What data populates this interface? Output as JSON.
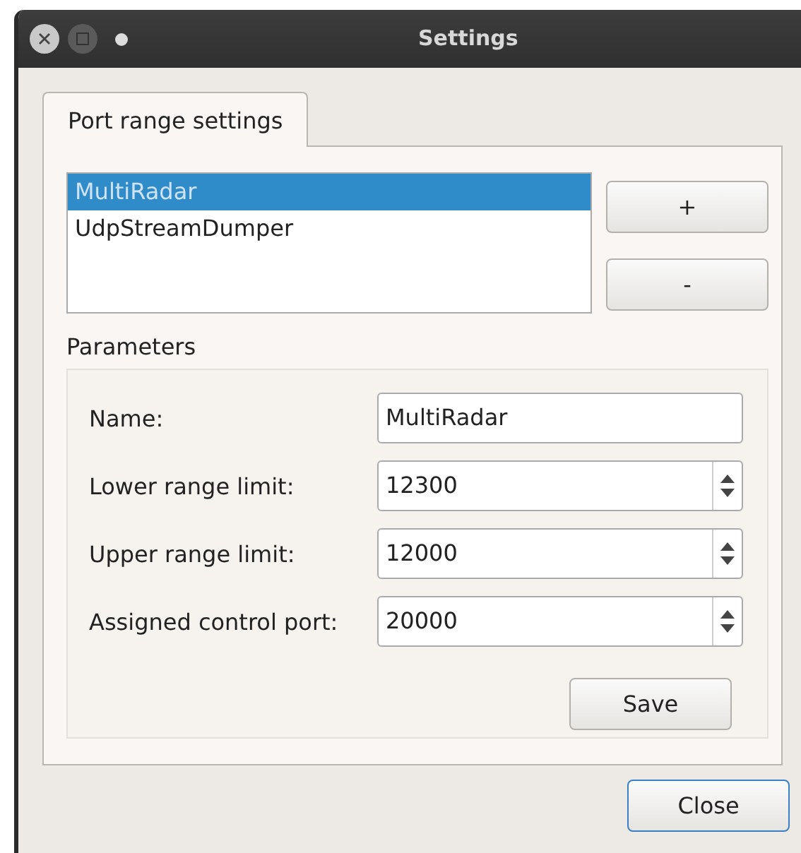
{
  "window": {
    "title": "Settings"
  },
  "tabs": [
    {
      "label": "Port range settings",
      "selected": true
    }
  ],
  "list": {
    "items": [
      {
        "label": "MultiRadar",
        "selected": true
      },
      {
        "label": "UdpStreamDumper",
        "selected": false
      }
    ]
  },
  "list_buttons": [
    "+",
    "-"
  ],
  "parameters": {
    "title": "Parameters",
    "fields": [
      {
        "kind": "text",
        "label": "Name:",
        "value": "MultiRadar"
      },
      {
        "kind": "spin",
        "label": "Lower range limit:",
        "value": "12300"
      },
      {
        "kind": "spin",
        "label": "Upper range limit:",
        "value": "12000"
      },
      {
        "kind": "spin",
        "label": "Assigned control port:",
        "value": "20000"
      }
    ],
    "save_button": {
      "label": "Save",
      "default": false
    }
  },
  "close_button": {
    "label": "Close",
    "default": true
  }
}
